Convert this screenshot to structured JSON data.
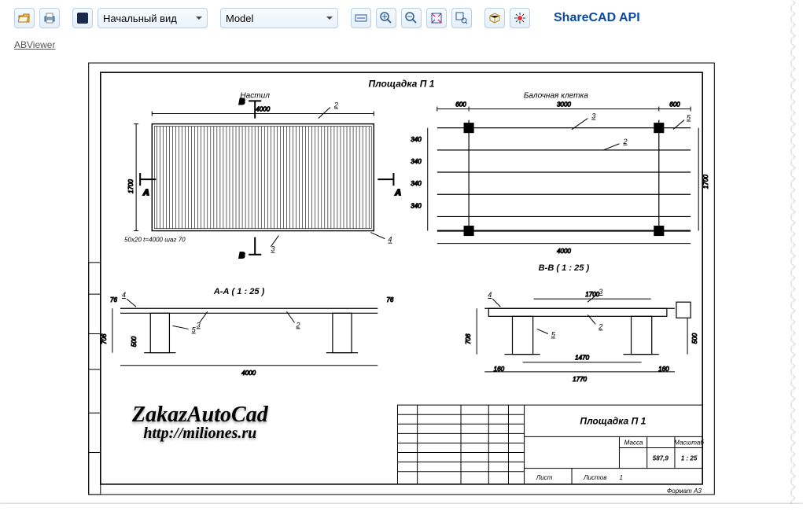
{
  "toolbar": {
    "views_select": "Начальный вид",
    "model_select": "Model"
  },
  "abviewer_link": "ABViewer",
  "api_link": "ShareCAD API",
  "watermark": {
    "line1": "ZakazAutoCad",
    "line2": "http://miliones.ru"
  },
  "drawing": {
    "title": "Площадка П 1",
    "subtitles": {
      "left": "Настил",
      "right": "Балочная клетка"
    },
    "section_aa": "А-А ( 1 : 25 )",
    "section_bb": "В-В ( 1 : 25 )",
    "dims": {
      "w4000": "4000",
      "h1700": "1700",
      "d600": "600",
      "d3000": "3000",
      "d340": "340",
      "d1470": "1470",
      "d1770": "1770",
      "d160": "160",
      "d76": "76",
      "d706": "706",
      "d500": "500",
      "note": "50x20 t=4000 шаг 70"
    },
    "callouts": {
      "c2": "2",
      "c3": "3",
      "c4": "4",
      "c5": "5",
      "A": "А",
      "B": "В"
    },
    "titleblock": {
      "name": "Площадка П 1",
      "mass": "587,9",
      "scale": "1 : 25",
      "format": "Формат А3",
      "sheet_label": "Лист",
      "sheets_label": "Листов",
      "sheets_val": "1",
      "mass_label": "Масса",
      "scale_label": "Масштаб"
    }
  }
}
